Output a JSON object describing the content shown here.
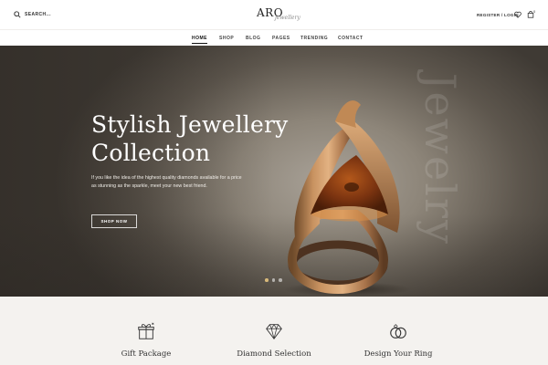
{
  "header": {
    "search_label": "SEARCH...",
    "logo_main": "ARO",
    "logo_script": "jewellery",
    "account_label": "REGISTER / LOGIN",
    "cart_count": "0"
  },
  "nav": {
    "items": [
      {
        "label": "HOME",
        "active": true
      },
      {
        "label": "SHOP"
      },
      {
        "label": "BLOG"
      },
      {
        "label": "PAGES"
      },
      {
        "label": "TRENDING"
      },
      {
        "label": "CONTACT"
      }
    ]
  },
  "hero": {
    "title_line1": "Stylish Jewellery",
    "title_line2": "Collection",
    "description": "If you like the idea of the highest quality diamonds available for a price as stunning as the sparkle, meet your new best friend.",
    "button_label": "SHOP NOW",
    "vertical_text": "Jewelry",
    "slides": 3,
    "active_slide": 1
  },
  "features": [
    {
      "title": "Gift Package",
      "icon": "gift-icon"
    },
    {
      "title": "Diamond Selection",
      "icon": "diamond-icon"
    },
    {
      "title": "Design Your Ring",
      "icon": "rings-icon"
    }
  ],
  "colors": {
    "accent": "#d8b97a",
    "feature_bg": "#f4f2ef"
  }
}
